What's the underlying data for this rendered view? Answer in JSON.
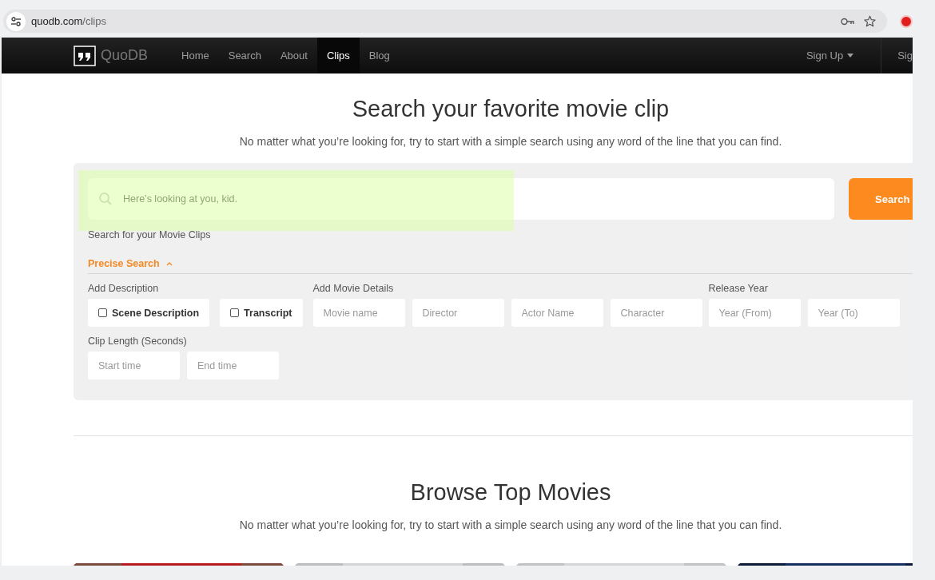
{
  "browser": {
    "url_host": "quodb.com",
    "url_path": "/clips"
  },
  "navbar": {
    "logo": "QuoDB",
    "items": [
      {
        "label": "Home",
        "selected": false
      },
      {
        "label": "Search",
        "selected": false
      },
      {
        "label": "About",
        "selected": false
      },
      {
        "label": "Clips",
        "selected": true
      },
      {
        "label": "Blog",
        "selected": false
      }
    ],
    "right_items": [
      {
        "label": "Sign Up",
        "kind": "dropdown"
      },
      {
        "label": "Sig",
        "kind": "link"
      }
    ]
  },
  "hero": {
    "title": "Search your favorite movie clip",
    "subtitle": "No matter what you’re looking for, try to start with a simple search using any word of the line that you can find."
  },
  "search": {
    "value": "Here’s looking at you, kid.",
    "button": "Search",
    "help": "Search for your Movie Clips",
    "precise_search": {
      "label": "Precise Search",
      "expanded": true
    },
    "groups": [
      {
        "label": "Add Description",
        "fields": [
          {
            "kind": "checkbox",
            "label": "Scene Description",
            "checked": false
          },
          {
            "kind": "checkbox",
            "label": "Transcript",
            "checked": false
          }
        ]
      },
      {
        "label": "Add Movie Details",
        "fields": [
          {
            "kind": "input",
            "placeholder": "Movie name"
          },
          {
            "kind": "input",
            "placeholder": "Director"
          },
          {
            "kind": "input",
            "placeholder": "Actor Name"
          },
          {
            "kind": "input",
            "placeholder": "Character"
          }
        ]
      },
      {
        "label": "Release Year",
        "fields": [
          {
            "kind": "input",
            "placeholder": "Year (From)"
          },
          {
            "kind": "input",
            "placeholder": "Year (To)"
          }
        ]
      }
    ],
    "clip_length": {
      "label": "Clip Length (Seconds)",
      "fields": [
        {
          "kind": "input",
          "placeholder": "Start time"
        },
        {
          "kind": "input",
          "placeholder": "End time"
        }
      ]
    }
  },
  "browse": {
    "title": "Browse Top Movies",
    "subtitle": "No matter what you’re looking for, try to start with a simple search using any word of the line that you can find."
  }
}
